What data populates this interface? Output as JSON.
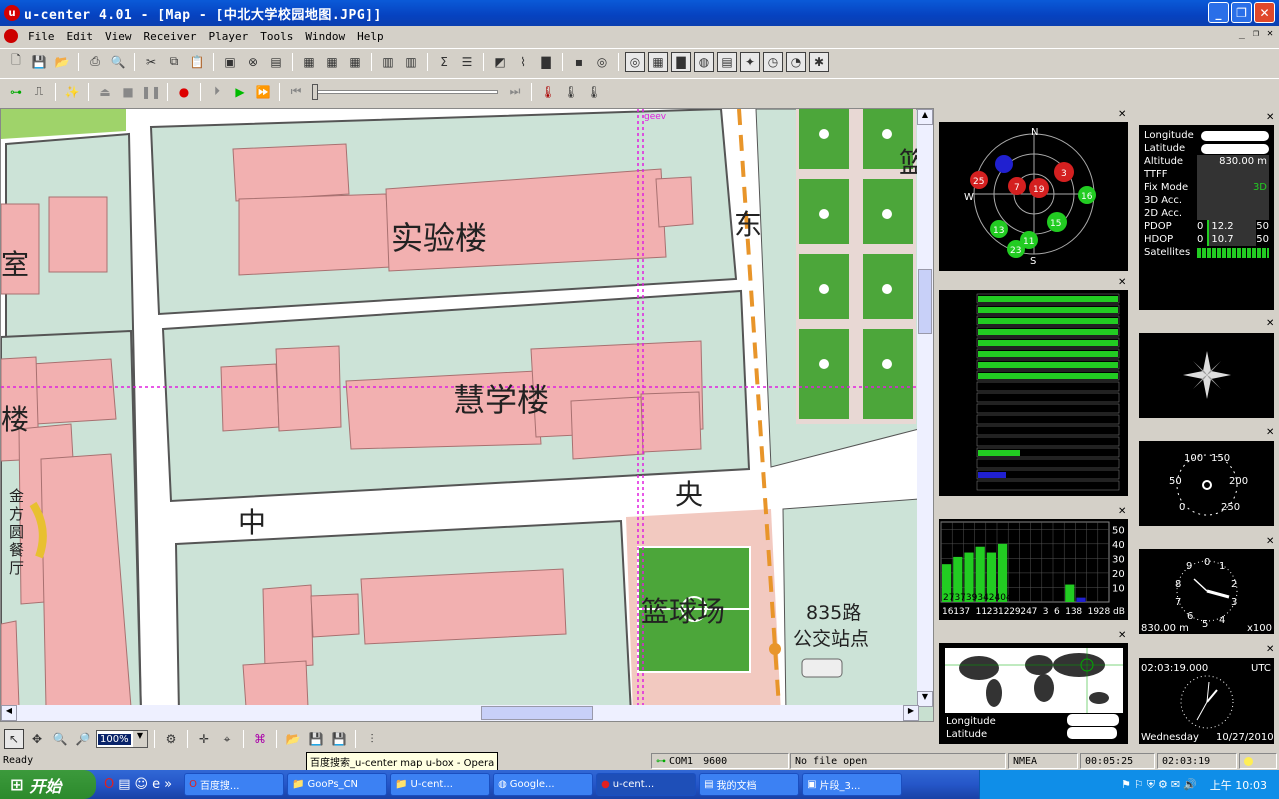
{
  "window": {
    "title": "u-center 4.01 - [Map - [中北大学校园地图.JPG]]"
  },
  "menu": [
    "File",
    "Edit",
    "View",
    "Receiver",
    "Player",
    "Tools",
    "Window",
    "Help"
  ],
  "map": {
    "labels": [
      "实验楼",
      "慧学楼",
      "东",
      "中",
      "央",
      "篮球场",
      "835路",
      "公交站点",
      "金方圆餐厅",
      "室",
      "楼",
      "篮"
    ],
    "marker": "geev"
  },
  "skyview": {
    "compass": [
      "N",
      "W",
      "S"
    ],
    "sats": [
      "25",
      "7",
      "19",
      "3",
      "16",
      "13",
      "11",
      "23",
      "15"
    ]
  },
  "dataview": {
    "longitude_label": "Longitude",
    "latitude_label": "Latitude",
    "altitude_label": "Altitude",
    "altitude_value": "830.00 m",
    "ttff_label": "TTFF",
    "fixmode_label": "Fix Mode",
    "fixmode_value": "3D",
    "acc3d_label": "3D Acc.",
    "acc2d_label": "2D Acc.",
    "pdop_label": "PDOP",
    "pdop_min": "0",
    "pdop_value": "12.2",
    "pdop_max": "50",
    "hdop_label": "HDOP",
    "hdop_min": "0",
    "hdop_value": "10.7",
    "hdop_max": "50",
    "satellites_label": "Satellites"
  },
  "cn_chart": {
    "type": "bar",
    "y_ticks": [
      "50",
      "40",
      "30",
      "20",
      "10"
    ],
    "x_labels": [
      "16",
      "13",
      "7",
      "11",
      "23",
      "12",
      "29",
      "24",
      "7",
      "3",
      "6",
      "13",
      "8",
      "19",
      "28"
    ],
    "unit": "dB",
    "values": [
      26,
      31,
      34,
      38,
      34,
      40,
      0,
      0,
      0,
      0,
      0,
      12,
      3,
      0,
      0
    ],
    "top_labels": "2737393424045",
    "ylim": [
      0,
      55
    ]
  },
  "speedo": {
    "labels": [
      "100",
      "150",
      "50",
      "200",
      "0",
      "250"
    ]
  },
  "altimeter": {
    "labels": [
      "0",
      "1",
      "2",
      "3",
      "4",
      "5",
      "6",
      "7",
      "8",
      "9"
    ],
    "value": "830.00 m",
    "scale": "x100"
  },
  "clock": {
    "time": "02:03:19.000",
    "zone": "UTC",
    "day": "Wednesday",
    "date": "10/27/2010"
  },
  "worldmap": {
    "longitude_label": "Longitude",
    "latitude_label": "Latitude"
  },
  "zoom": "100%",
  "status": {
    "ready": "Ready",
    "port": "COM1",
    "baud": "9600",
    "file": "No file open",
    "protocol": "NMEA",
    "elapsed": "00:05:25",
    "time": "02:03:19"
  },
  "tooltip": "百度搜索_u-center map u-box - Opera",
  "taskbar": {
    "start": "开始",
    "tasks": [
      "百度搜...",
      "GooPs_CN",
      "U-cent...",
      "Google...",
      "u-cent...",
      "我的文档",
      "片段_3..."
    ],
    "clock": "上午 10:03"
  },
  "colors": {
    "accent": "#0a5ad8",
    "sat_green": "#22cc22",
    "sat_red": "#d42020",
    "sat_blue": "#2020d0",
    "crosshair": "#e020e0"
  }
}
